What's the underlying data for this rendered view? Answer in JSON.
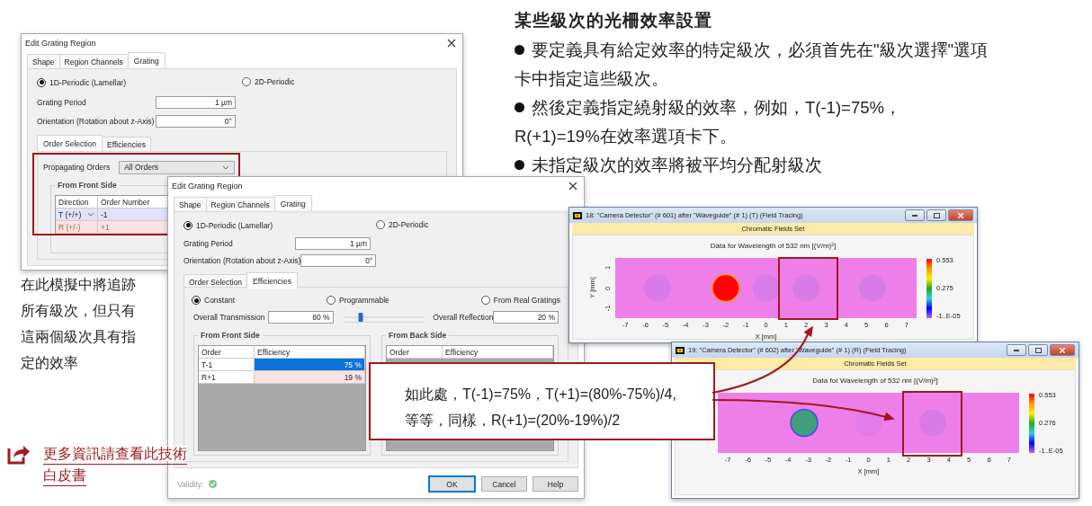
{
  "slide_text": {
    "heading": "某些級次的光柵效率設置",
    "bullets": [
      "要定義具有給定效率的特定級次，必須首先在\"級次選擇\"選項卡中指定這些級次。",
      "然後定義指定繞射級的效率，例如，T(-1)=75%，R(+1)=19%在效率選項卡下。",
      "未指定級次的效率將被平均分配射級次"
    ]
  },
  "side_note": "在此模擬中將追跡所有級次，但只有這兩個級次具有指定的效率",
  "link": "更多資訊請查看此技術白皮書",
  "dialogs": [
    {
      "kind": "order_selection",
      "title": "Edit Grating Region",
      "tabs": [
        {
          "label": "Shape",
          "selected": false
        },
        {
          "label": "Region Channels",
          "selected": false
        },
        {
          "label": "Grating",
          "selected": true
        }
      ],
      "periodicity": [
        {
          "label": "1D-Periodic (Lamellar)",
          "selected": true
        },
        {
          "label": "2D-Periodic",
          "selected": false
        }
      ],
      "fields": [
        {
          "label": "Grating Period",
          "value": "1 µm"
        },
        {
          "label": "Orientation (Rotation about z-Axis)",
          "value": "0°"
        }
      ],
      "subtabs": [
        {
          "label": "Order Selection",
          "selected": true
        },
        {
          "label": "Efficiencies",
          "selected": false
        }
      ],
      "propagating_orders": {
        "label": "Propagating Orders",
        "value": "All Orders"
      },
      "front_side": {
        "title": "From Front Side",
        "columns": [
          "Direction",
          "Order Number"
        ],
        "rows": [
          {
            "cells": [
              "T (+/+)",
              "-1"
            ],
            "selected": true
          },
          {
            "cells": [
              "R (+/-)",
              "+1"
            ],
            "selected": false
          }
        ]
      }
    },
    {
      "kind": "efficiencies",
      "title": "Edit Grating Region",
      "tabs": [
        {
          "label": "Shape",
          "selected": false
        },
        {
          "label": "Region Channels",
          "selected": false
        },
        {
          "label": "Grating",
          "selected": true
        }
      ],
      "periodicity": [
        {
          "label": "1D-Periodic (Lamellar)",
          "selected": true
        },
        {
          "label": "2D-Periodic",
          "selected": false
        }
      ],
      "fields": [
        {
          "label": "Grating Period",
          "value": "1 µm"
        },
        {
          "label": "Orientation (Rotation about z-Axis)",
          "value": "0°"
        }
      ],
      "subtabs": [
        {
          "label": "Order Selection",
          "selected": false
        },
        {
          "label": "Efficiencies",
          "selected": true
        }
      ],
      "modes": [
        {
          "label": "Constant",
          "selected": true
        },
        {
          "label": "Programmable",
          "selected": false
        },
        {
          "label": "From Real Gratings",
          "selected": false
        }
      ],
      "transmission": {
        "label": "Overall Transmission",
        "value": "80 %"
      },
      "slider": {
        "level": 0.21
      },
      "reflection": {
        "label": "Overall Reflection",
        "value": "20 %"
      },
      "front_side": {
        "title": "From Front Side",
        "columns": [
          "Order",
          "Efficiency"
        ],
        "rows": [
          {
            "cells": [
              "T-1",
              "75 %"
            ],
            "selected": true
          },
          {
            "cells": [
              "R+1",
              "19 %"
            ],
            "selected": false
          }
        ]
      },
      "back_side": {
        "title": "From Back Side",
        "columns": [
          "Order",
          "Efficiency"
        ]
      },
      "validity": "Validity:",
      "buttons": [
        {
          "label": "OK",
          "default": true
        },
        {
          "label": "Cancel",
          "default": false
        },
        {
          "label": "Help",
          "default": false
        }
      ]
    }
  ],
  "detectors": [
    {
      "kind": "transmission",
      "title": "18: \"Camera Detector\" (# 601) after \"Waveguide\" (# 1) (T) (Field Tracing)",
      "banner": "Chromatic Fields Set",
      "plot_title": "Data for Wavelength of 532 nm  [(V/m)²]",
      "y_label": "Y [mm]",
      "y_ticks": [
        "1",
        "0",
        "-1"
      ],
      "x_label": "X [mm]",
      "x_ticks": [
        "-7",
        "-6",
        "-5",
        "-4",
        "-3",
        "-2",
        "-1",
        "0",
        "1",
        "2",
        "3",
        "4",
        "5",
        "6",
        "7"
      ],
      "scale_labels": [
        "0.553",
        "0.275",
        "-1..E-05"
      ]
    },
    {
      "kind": "reflection",
      "title": "19: \"Camera Detector\" (# 602) after \"Waveguide\" (# 1) (R) (Field Tracing)",
      "banner": "Chromatic Fields Set",
      "plot_title": "Data for Wavelength of 532 nm  [(V/m)²]",
      "x_label": "X [mm]",
      "x_ticks": [
        "-7",
        "-6",
        "-5",
        "-4",
        "-3",
        "-2",
        "-1",
        "0",
        "1",
        "2",
        "3",
        "4",
        "5",
        "6",
        "7"
      ],
      "scale_labels": [
        "0.553",
        "0.276",
        "-1..E-05"
      ]
    }
  ],
  "callout": "如此處，T(-1)=75%，T(+1)=(80%-75%)/4, 等等，同樣，R(+1)=(20%-19%)/2"
}
